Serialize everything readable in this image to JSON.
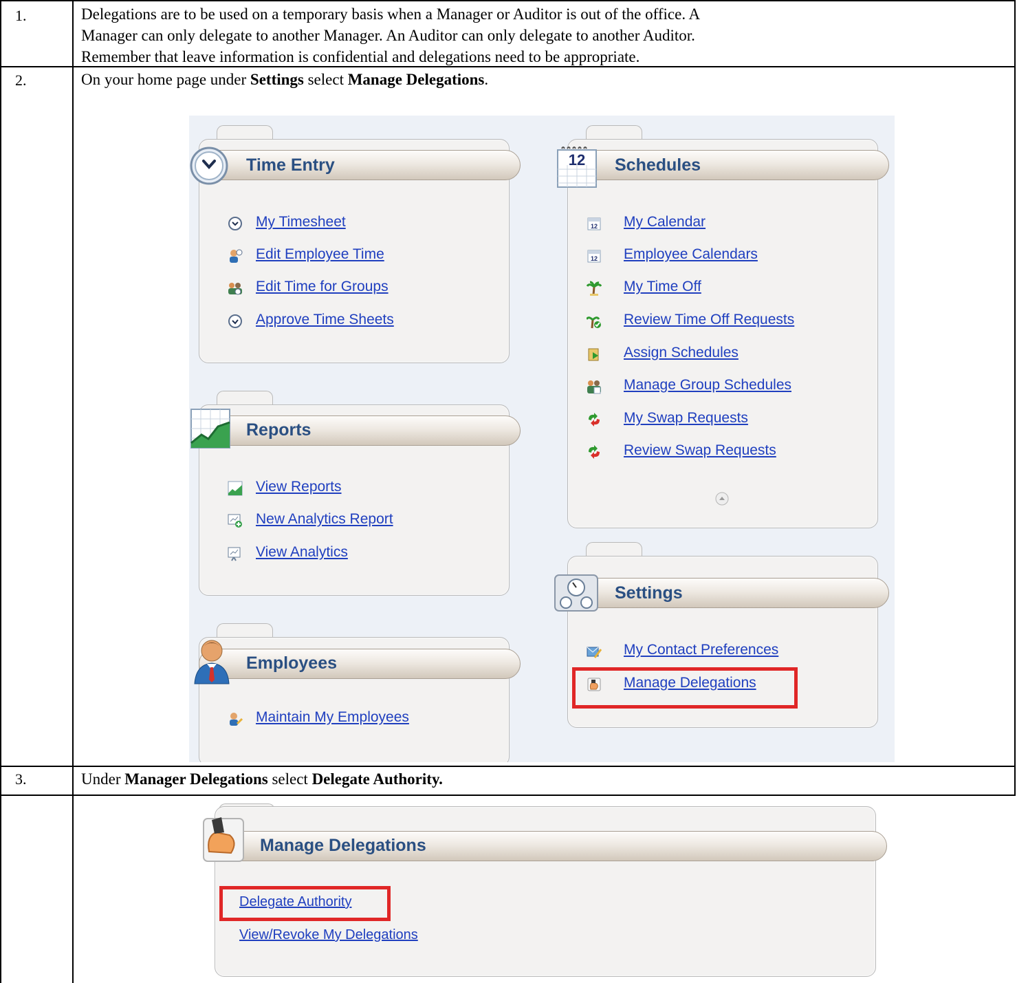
{
  "rows": [
    {
      "number": "1.",
      "lines": [
        "Delegations are to be used on a temporary basis when a Manager or Auditor is out of the office.  A",
        "Manager can only delegate to another Manager.  An Auditor can only delegate to another Auditor.",
        "Remember that leave information is confidential and delegations need to be appropriate."
      ]
    },
    {
      "number": "2.",
      "text_parts": [
        "On your home page under ",
        "Settings",
        " select ",
        "Manage Delegations",
        "."
      ]
    },
    {
      "number": "3.",
      "text_parts": [
        "Under ",
        "Manager Delegations",
        " select ",
        "Delegate Authority."
      ]
    }
  ],
  "homepage": {
    "time_entry": {
      "title": "Time Entry",
      "links": [
        "My Timesheet",
        "Edit Employee Time",
        "Edit Time for Groups",
        "Approve Time Sheets"
      ]
    },
    "reports": {
      "title": "Reports",
      "links": [
        "View Reports",
        "New Analytics Report",
        "View Analytics"
      ]
    },
    "employees": {
      "title": "Employees",
      "links": [
        "Maintain My Employees"
      ]
    },
    "schedules": {
      "title": "Schedules",
      "icon_day": "12",
      "links": [
        "My Calendar",
        "Employee Calendars",
        "My Time Off",
        "Review Time Off Requests",
        "Assign Schedules",
        "Manage Group Schedules",
        "My Swap Requests",
        "Review Swap Requests"
      ]
    },
    "settings": {
      "title": "Settings",
      "links": [
        "My Contact Preferences",
        "Manage Delegations"
      ]
    }
  },
  "delegations_panel": {
    "title": "Manage Delegations",
    "links": [
      "Delegate Authority",
      "View/Revoke My Delegations"
    ]
  },
  "colors": {
    "highlight": "#e02727",
    "link": "#1f3fbf",
    "title": "#2a4f82"
  }
}
